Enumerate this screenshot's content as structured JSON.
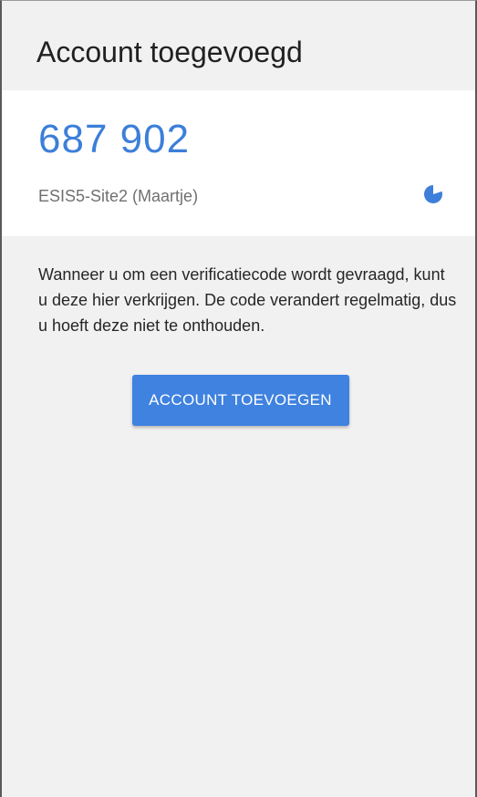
{
  "header": {
    "title": "Account toegevoegd"
  },
  "account_card": {
    "code": "687 902",
    "account_name": "ESIS5-Site2 (Maartje)",
    "timer_icon": "countdown-timer-icon",
    "timer_remaining_fraction": 0.8
  },
  "info": {
    "text": "Wanneer u om een verificatiecode wordt gevraagd, kunt u deze hier verkrijgen. De code verandert regelmatig, dus u hoeft deze niet te onthouden."
  },
  "actions": {
    "add_account_label": "ACCOUNT TOEVOEGEN"
  },
  "colors": {
    "accent": "#3d7fd9",
    "button": "#3f82e0",
    "background": "#f1f1f1",
    "card": "#ffffff"
  }
}
